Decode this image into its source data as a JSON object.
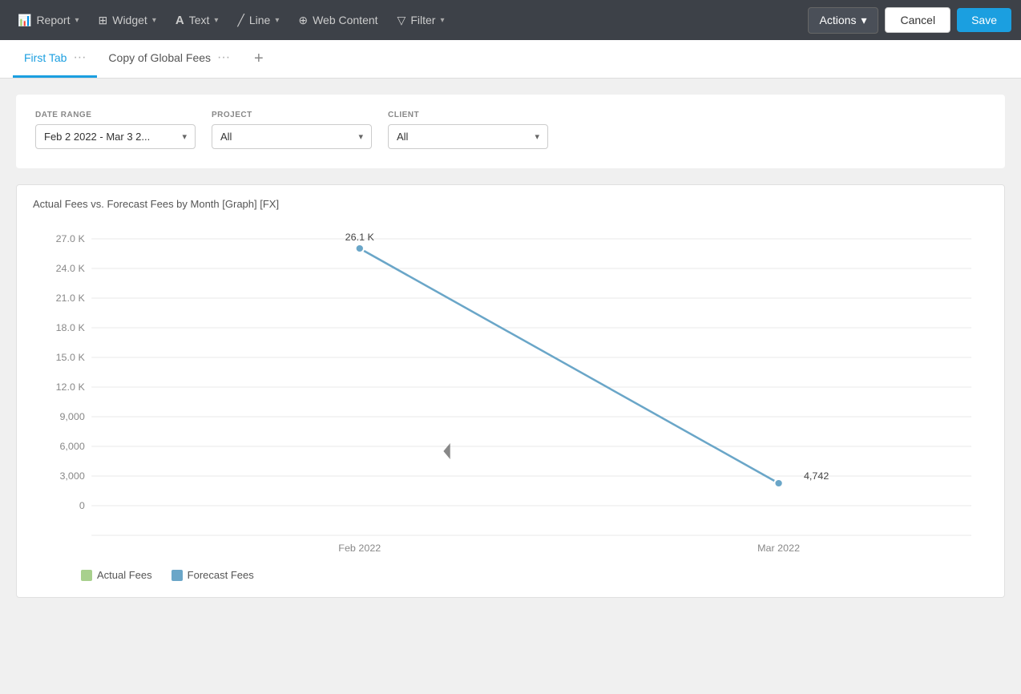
{
  "navbar": {
    "items": [
      {
        "id": "report",
        "label": "Report",
        "icon": "📊",
        "hasChevron": true
      },
      {
        "id": "widget",
        "label": "Widget",
        "icon": "▦",
        "hasChevron": true
      },
      {
        "id": "text",
        "label": "Text",
        "icon": "A",
        "hasChevron": true
      },
      {
        "id": "line",
        "label": "Line",
        "icon": "╱",
        "hasChevron": true
      },
      {
        "id": "web-content",
        "label": "Web Content",
        "icon": "⊕",
        "hasChevron": false
      },
      {
        "id": "filter",
        "label": "Filter",
        "icon": "⊿",
        "hasChevron": true
      }
    ],
    "actions_label": "Actions",
    "cancel_label": "Cancel",
    "save_label": "Save"
  },
  "tabs": [
    {
      "id": "first-tab",
      "label": "First Tab",
      "active": true
    },
    {
      "id": "copy-global-fees",
      "label": "Copy of Global Fees",
      "active": false
    }
  ],
  "tab_add_label": "+",
  "filters": {
    "date_range": {
      "label": "DATE RANGE",
      "value": "Feb 2 2022 - Mar 3 2..."
    },
    "project": {
      "label": "PROJECT",
      "value": "All"
    },
    "client": {
      "label": "CLIENT",
      "value": "All"
    }
  },
  "chart": {
    "title": "Actual Fees vs. Forecast Fees by Month [Graph] [FX]",
    "y_labels": [
      "27.0 K",
      "24.0 K",
      "21.0 K",
      "18.0 K",
      "15.0 K",
      "12.0 K",
      "9,000",
      "6,000",
      "3,000",
      "0"
    ],
    "x_labels": [
      "Feb 2022",
      "Mar 2022"
    ],
    "data_point_1_label": "26.1 K",
    "data_point_2_label": "4,742",
    "legend": [
      {
        "id": "actual-fees",
        "label": "Actual Fees",
        "color": "#a8d08d"
      },
      {
        "id": "forecast-fees",
        "label": "Forecast Fees",
        "color": "#6aa6c8"
      }
    ]
  }
}
